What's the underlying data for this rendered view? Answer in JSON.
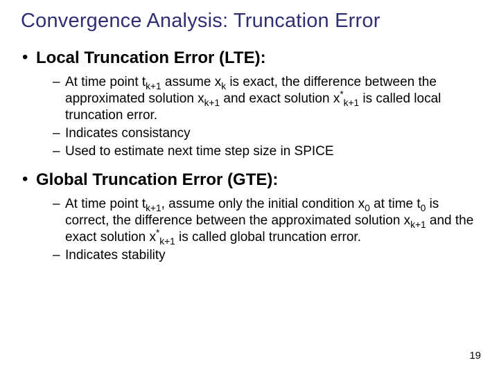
{
  "title": "Convergence Analysis: Truncation Error",
  "bullets": [
    {
      "heading": "Local Truncation Error (LTE):",
      "items": [
        {
          "pre": "At time point t",
          "sub1": "k+1",
          "mid1": " assume x",
          "sub2": "k",
          "mid2": " is exact, the difference between the approximated solution x",
          "sub3": "k+1",
          "mid3": " and exact solution x",
          "sup": "*",
          "sub4": "k+1",
          "post": " is called local truncation error."
        },
        {
          "plain": "Indicates consistancy"
        },
        {
          "plain": "Used to estimate next time step size in SPICE"
        }
      ]
    },
    {
      "heading": "Global Truncation Error (GTE):",
      "items": [
        {
          "pre": "At time point t",
          "sub1": "k+1",
          "mid1": ", assume only the initial condition x",
          "sub2": "0",
          "mid2": " at time t",
          "sub3": "0",
          "mid3": " is correct, the difference between the approximated solution x",
          "sub4": "k+1",
          "mid4": " and the exact solution x",
          "sup": "*",
          "sub5": "k+1",
          "post": " is called global truncation error."
        },
        {
          "plain": "Indicates stability"
        }
      ]
    }
  ],
  "page_number": "19"
}
